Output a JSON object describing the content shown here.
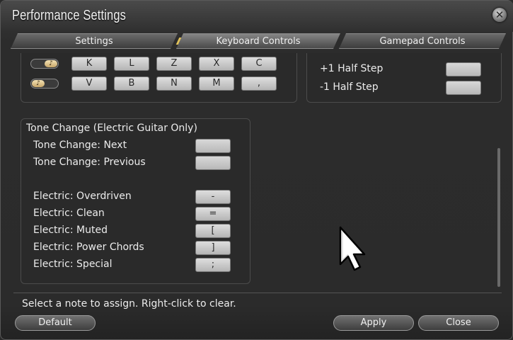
{
  "window": {
    "title": "Performance Settings",
    "close_glyph": "✕"
  },
  "tabs": [
    {
      "label": "Settings"
    },
    {
      "label": "Keyboard Controls"
    },
    {
      "label": "Gamepad Controls"
    }
  ],
  "keys": {
    "row1": [
      "K",
      "L",
      "Z",
      "X",
      "C"
    ],
    "row2": [
      "V",
      "B",
      "N",
      "M",
      ","
    ],
    "toggle_glyph": "♪"
  },
  "half_step": {
    "up_label": "+1 Half Step",
    "down_label": "-1 Half Step"
  },
  "tone": {
    "heading": "Tone Change (Electric Guitar Only)",
    "next_label": "Tone Change: Next",
    "prev_label": "Tone Change: Previous",
    "items": [
      {
        "label": "Electric: Overdriven",
        "key": "-"
      },
      {
        "label": "Electric: Clean",
        "key": "="
      },
      {
        "label": "Electric: Muted",
        "key": "["
      },
      {
        "label": "Electric: Power Chords",
        "key": "]"
      },
      {
        "label": "Electric: Special",
        "key": ";"
      }
    ]
  },
  "footer": {
    "hint": "Select a note to assign. Right-click to clear.",
    "default_label": "Default",
    "apply_label": "Apply",
    "close_label": "Close"
  },
  "colors": {
    "accent": "#e2c35a",
    "panel_bg": "#2a2a2a",
    "key_bg": "#d0d0d0"
  }
}
